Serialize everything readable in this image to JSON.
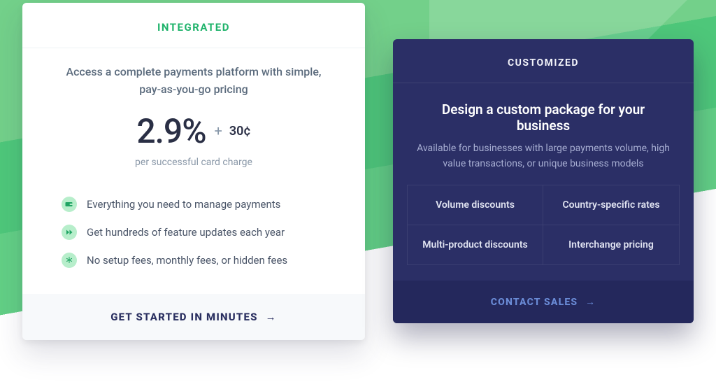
{
  "left": {
    "header": "INTEGRATED",
    "description": "Access a complete payments platform with simple, pay-as-you-go pricing",
    "price_percent": "2.9%",
    "price_plus": "+",
    "price_flat": "30¢",
    "price_sub": "per successful card charge",
    "features": [
      "Everything you need to manage payments",
      "Get hundreds of feature updates each year",
      "No setup fees, monthly fees, or hidden fees"
    ],
    "cta": "GET STARTED IN MINUTES",
    "cta_arrow": "→"
  },
  "right": {
    "header": "CUSTOMIZED",
    "title": "Design a custom package for your business",
    "description": "Available for businesses with large payments volume, high value transactions, or unique business models",
    "cells": [
      "Volume discounts",
      "Country-specific rates",
      "Multi-product discounts",
      "Interchange pricing"
    ],
    "cta": "CONTACT SALES",
    "cta_arrow": "→"
  }
}
